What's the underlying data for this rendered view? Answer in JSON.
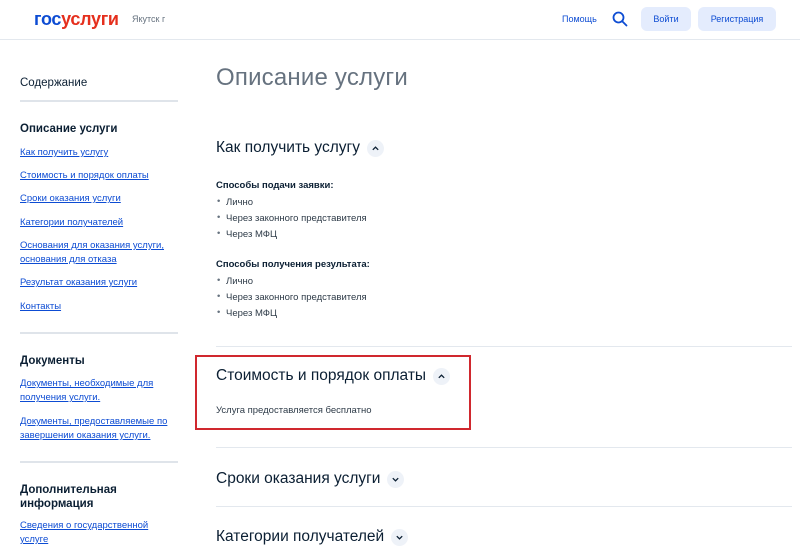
{
  "header": {
    "logo_part1": "гос",
    "logo_part2": "услуги",
    "region": "Якутск г",
    "help": "Помощь",
    "login": "Войти",
    "register": "Регистрация"
  },
  "sidebar": {
    "title": "Содержание",
    "sections": [
      {
        "heading": "Описание услуги",
        "links": [
          "Как получить услугу",
          "Стоимость и порядок оплаты",
          "Сроки оказания услуги",
          "Категории получателей",
          "Основания для оказания услуги,",
          "основания для отказа",
          "Результат оказания услуги",
          "Контакты"
        ]
      },
      {
        "heading": "Документы",
        "links": [
          "Документы, необходимые для",
          "получения услуги.",
          "Документы, предоставляемые по",
          "завершении оказания услуги."
        ]
      },
      {
        "heading_line1": "Дополнительная",
        "heading_line2": "информация",
        "links": [
          "Сведения о государственной",
          "услуге"
        ]
      }
    ]
  },
  "main": {
    "title": "Описание услуги",
    "how_to": {
      "heading": "Как получить услугу",
      "submit_label": "Способы подачи заявки:",
      "submit_items": [
        "Лично",
        "Через законного представителя",
        "Через МФЦ"
      ],
      "result_label": "Способы получения результата:",
      "result_items": [
        "Лично",
        "Через законного представителя",
        "Через МФЦ"
      ]
    },
    "cost": {
      "heading": "Стоимость и порядок оплаты",
      "text": "Услуга предоставляется бесплатно"
    },
    "terms": {
      "heading": "Сроки оказания услуги"
    },
    "categories": {
      "heading": "Категории получателей"
    }
  },
  "colors": {
    "brand_blue": "#0d4cd3",
    "brand_red": "#e52f1d",
    "highlight_red": "#d0282e"
  }
}
